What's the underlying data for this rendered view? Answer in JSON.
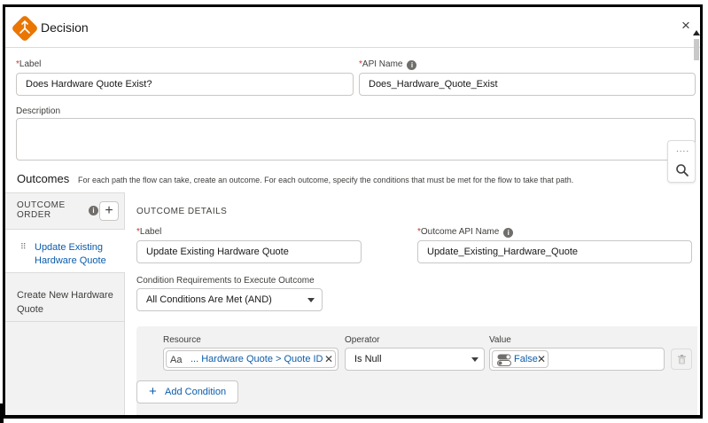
{
  "modal": {
    "title": "Decision",
    "close_glyph": "×"
  },
  "form": {
    "required_marker": "*",
    "label_label": "Label",
    "label_value": "Does Hardware Quote Exist?",
    "api_name_label": "API Name",
    "api_name_value": "Does_Hardware_Quote_Exist",
    "description_label": "Description",
    "description_value": ""
  },
  "outcomes": {
    "title": "Outcomes",
    "description": "For each path the flow can take, create an outcome. For each outcome, specify the conditions that must be met for the flow to take that path.",
    "order_label": "OUTCOME ORDER",
    "add_glyph": "+",
    "items": [
      {
        "label": "Update Existing Hardware Quote",
        "active": true
      },
      {
        "label": "Create New Hardware Quote",
        "active": false
      }
    ]
  },
  "details": {
    "title": "OUTCOME DETAILS",
    "label_label": "Label",
    "label_value": "Update Existing Hardware Quote",
    "api_name_label": "Outcome API Name",
    "api_name_value": "Update_Existing_Hardware_Quote",
    "condition_req_label": "Condition Requirements to Execute Outcome",
    "condition_req_value": "All Conditions Are Met (AND)"
  },
  "condition": {
    "resource_label": "Resource",
    "resource_value": "... Hardware Quote > Quote ID",
    "operator_label": "Operator",
    "operator_value": "Is Null",
    "value_label": "Value",
    "value_value": "False",
    "remove_glyph": "✕",
    "add_condition_label": "Add Condition",
    "text_icon_glyph": "Aa"
  },
  "tools": {
    "dots": "....",
    "search_icon": "search-icon"
  },
  "colors": {
    "brand_orange": "#ea7600",
    "link_blue": "#0b5cab",
    "required_red": "#c23934"
  }
}
